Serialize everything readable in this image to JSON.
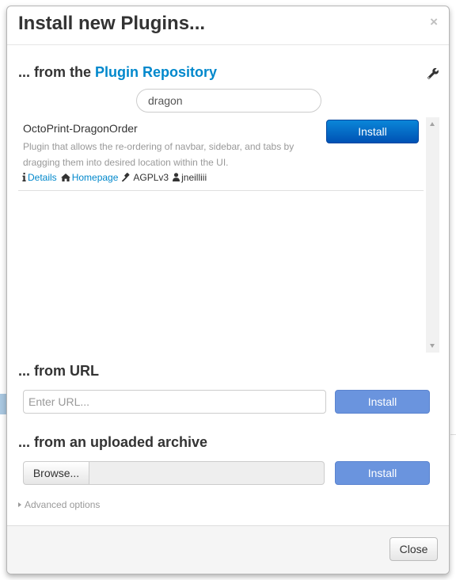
{
  "dialog": {
    "title": "Install new Plugins...",
    "close_symbol": "×"
  },
  "repository": {
    "heading_prefix": "... from the ",
    "heading_link": "Plugin Repository",
    "settings_icon": "wrench-icon",
    "search_value": "dragon",
    "plugins": [
      {
        "name": "OctoPrint-DragonOrder",
        "description": "Plugin that allows the re-ordering of navbar, sidebar, and tabs by dragging them into desired location within the UI.",
        "details_label": "Details",
        "homepage_label": "Homepage",
        "license": "AGPLv3",
        "author": "jneilliii",
        "install_label": "Install"
      }
    ]
  },
  "from_url": {
    "heading": "... from URL",
    "placeholder": "Enter URL...",
    "install_label": "Install"
  },
  "from_archive": {
    "heading": "... from an uploaded archive",
    "browse_label": "Browse...",
    "install_label": "Install"
  },
  "advanced_label": "Advanced options",
  "footer": {
    "close_label": "Close"
  },
  "colors": {
    "link": "#0088cc",
    "primary_button": "#0062c4",
    "disabled_button": "#6a94de"
  }
}
